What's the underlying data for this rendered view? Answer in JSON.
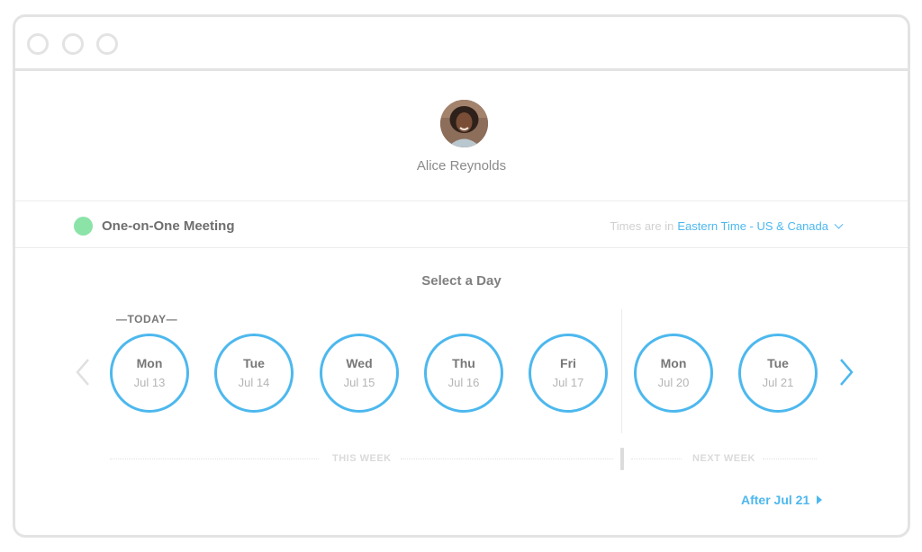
{
  "profile": {
    "name": "Alice Reynolds"
  },
  "meeting": {
    "title": "One-on-One Meeting",
    "status_color": "#8be3a8",
    "timezone_label": "Times are in",
    "timezone_value": "Eastern Time - US & Canada"
  },
  "calendar": {
    "title": "Select a Day",
    "today_label": "—TODAY—",
    "days": [
      {
        "name": "Mon",
        "date": "Jul 13"
      },
      {
        "name": "Tue",
        "date": "Jul 14"
      },
      {
        "name": "Wed",
        "date": "Jul 15"
      },
      {
        "name": "Thu",
        "date": "Jul 16"
      },
      {
        "name": "Fri",
        "date": "Jul 17"
      },
      {
        "name": "Mon",
        "date": "Jul 20"
      },
      {
        "name": "Tue",
        "date": "Jul 21"
      }
    ],
    "this_week_label": "THIS WEEK",
    "next_week_label": "NEXT WEEK",
    "after_link": "After Jul 21"
  },
  "icons": {
    "prev": "chevron-left-icon",
    "next": "chevron-right-icon",
    "caret": "caret-right-icon"
  },
  "colors": {
    "accent": "#4db8ee",
    "border": "#e3e3e3"
  }
}
